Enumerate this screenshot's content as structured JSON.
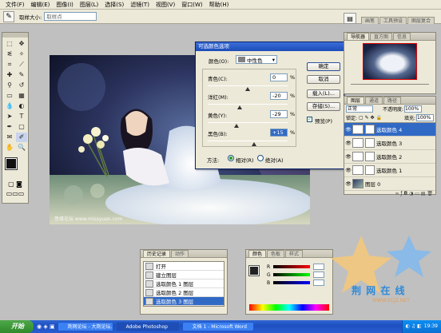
{
  "menu": [
    "文件(F)",
    "编辑(E)",
    "图像(I)",
    "图层(L)",
    "选择(S)",
    "滤镜(T)",
    "视图(V)",
    "窗口(W)",
    "帮助(H)"
  ],
  "options": {
    "sample_label": "取样大小:",
    "sample_value": "取样点"
  },
  "palette_well_tabs": [
    "画笔",
    "工具预设",
    "图层复合"
  ],
  "photo": {
    "watermark": "思缘论坛 www.missyuan.com"
  },
  "dialog": {
    "title": "可选颜色选项",
    "color_label": "颜色(O):",
    "color_value": "中性色",
    "cyan_label": "青色(C):",
    "cyan_value": "0",
    "magenta_label": "洋红(M):",
    "magenta_value": "-20",
    "yellow_label": "黄色(Y):",
    "yellow_value": "-29",
    "black_label": "黑色(B):",
    "black_value": "+15",
    "percent": "%",
    "ok": "确定",
    "cancel": "取消",
    "load": "载入(L)...",
    "save": "存储(S)...",
    "preview": "预览(P)",
    "method_label": "方法:",
    "relative": "相对(R)",
    "absolute": "绝对(A)"
  },
  "sliders": {
    "cyan": 0,
    "magenta": -20,
    "yellow": -29,
    "black": 15
  },
  "navigator": {
    "tabs": [
      "导航器",
      "直方图",
      "信息"
    ]
  },
  "layers": {
    "tabs": [
      "图层",
      "通道",
      "路径"
    ],
    "blend_mode": "正常",
    "opacity_label": "不透明度:",
    "opacity_value": "100%",
    "lock_label": "锁定:",
    "fill_label": "填充:",
    "fill_value": "100%",
    "items": [
      {
        "name": "选取颜色 4",
        "selected": true
      },
      {
        "name": "选取颜色 3",
        "selected": false
      },
      {
        "name": "选取颜色 2",
        "selected": false
      },
      {
        "name": "选取颜色 1",
        "selected": false
      },
      {
        "name": "图层 0",
        "selected": false
      }
    ]
  },
  "history": {
    "tabs": [
      "历史记录",
      "动作"
    ],
    "items": [
      {
        "name": "打开",
        "selected": false
      },
      {
        "name": "建立图层",
        "selected": false
      },
      {
        "name": "选取颜色 1 图层",
        "selected": false
      },
      {
        "name": "选取颜色 2 图层",
        "selected": false
      },
      {
        "name": "选取颜色 3 图层",
        "selected": true
      }
    ]
  },
  "color_panel": {
    "tabs": [
      "颜色",
      "色板",
      "样式"
    ],
    "channels": [
      "R",
      "G",
      "B"
    ]
  },
  "brand": {
    "text": "荆 网 在 线",
    "sub": "WWW.ECJZ.NET"
  },
  "taskbar": {
    "start": "开始",
    "tasks": [
      "荆网论坛 - 大荆论坛...",
      "Adobe Photoshop",
      "文档 1 - Microsoft Word"
    ],
    "clock": "19:39"
  },
  "colors": {
    "xp_blue": "#316ac5",
    "title_blue": "#1c4cb8"
  }
}
